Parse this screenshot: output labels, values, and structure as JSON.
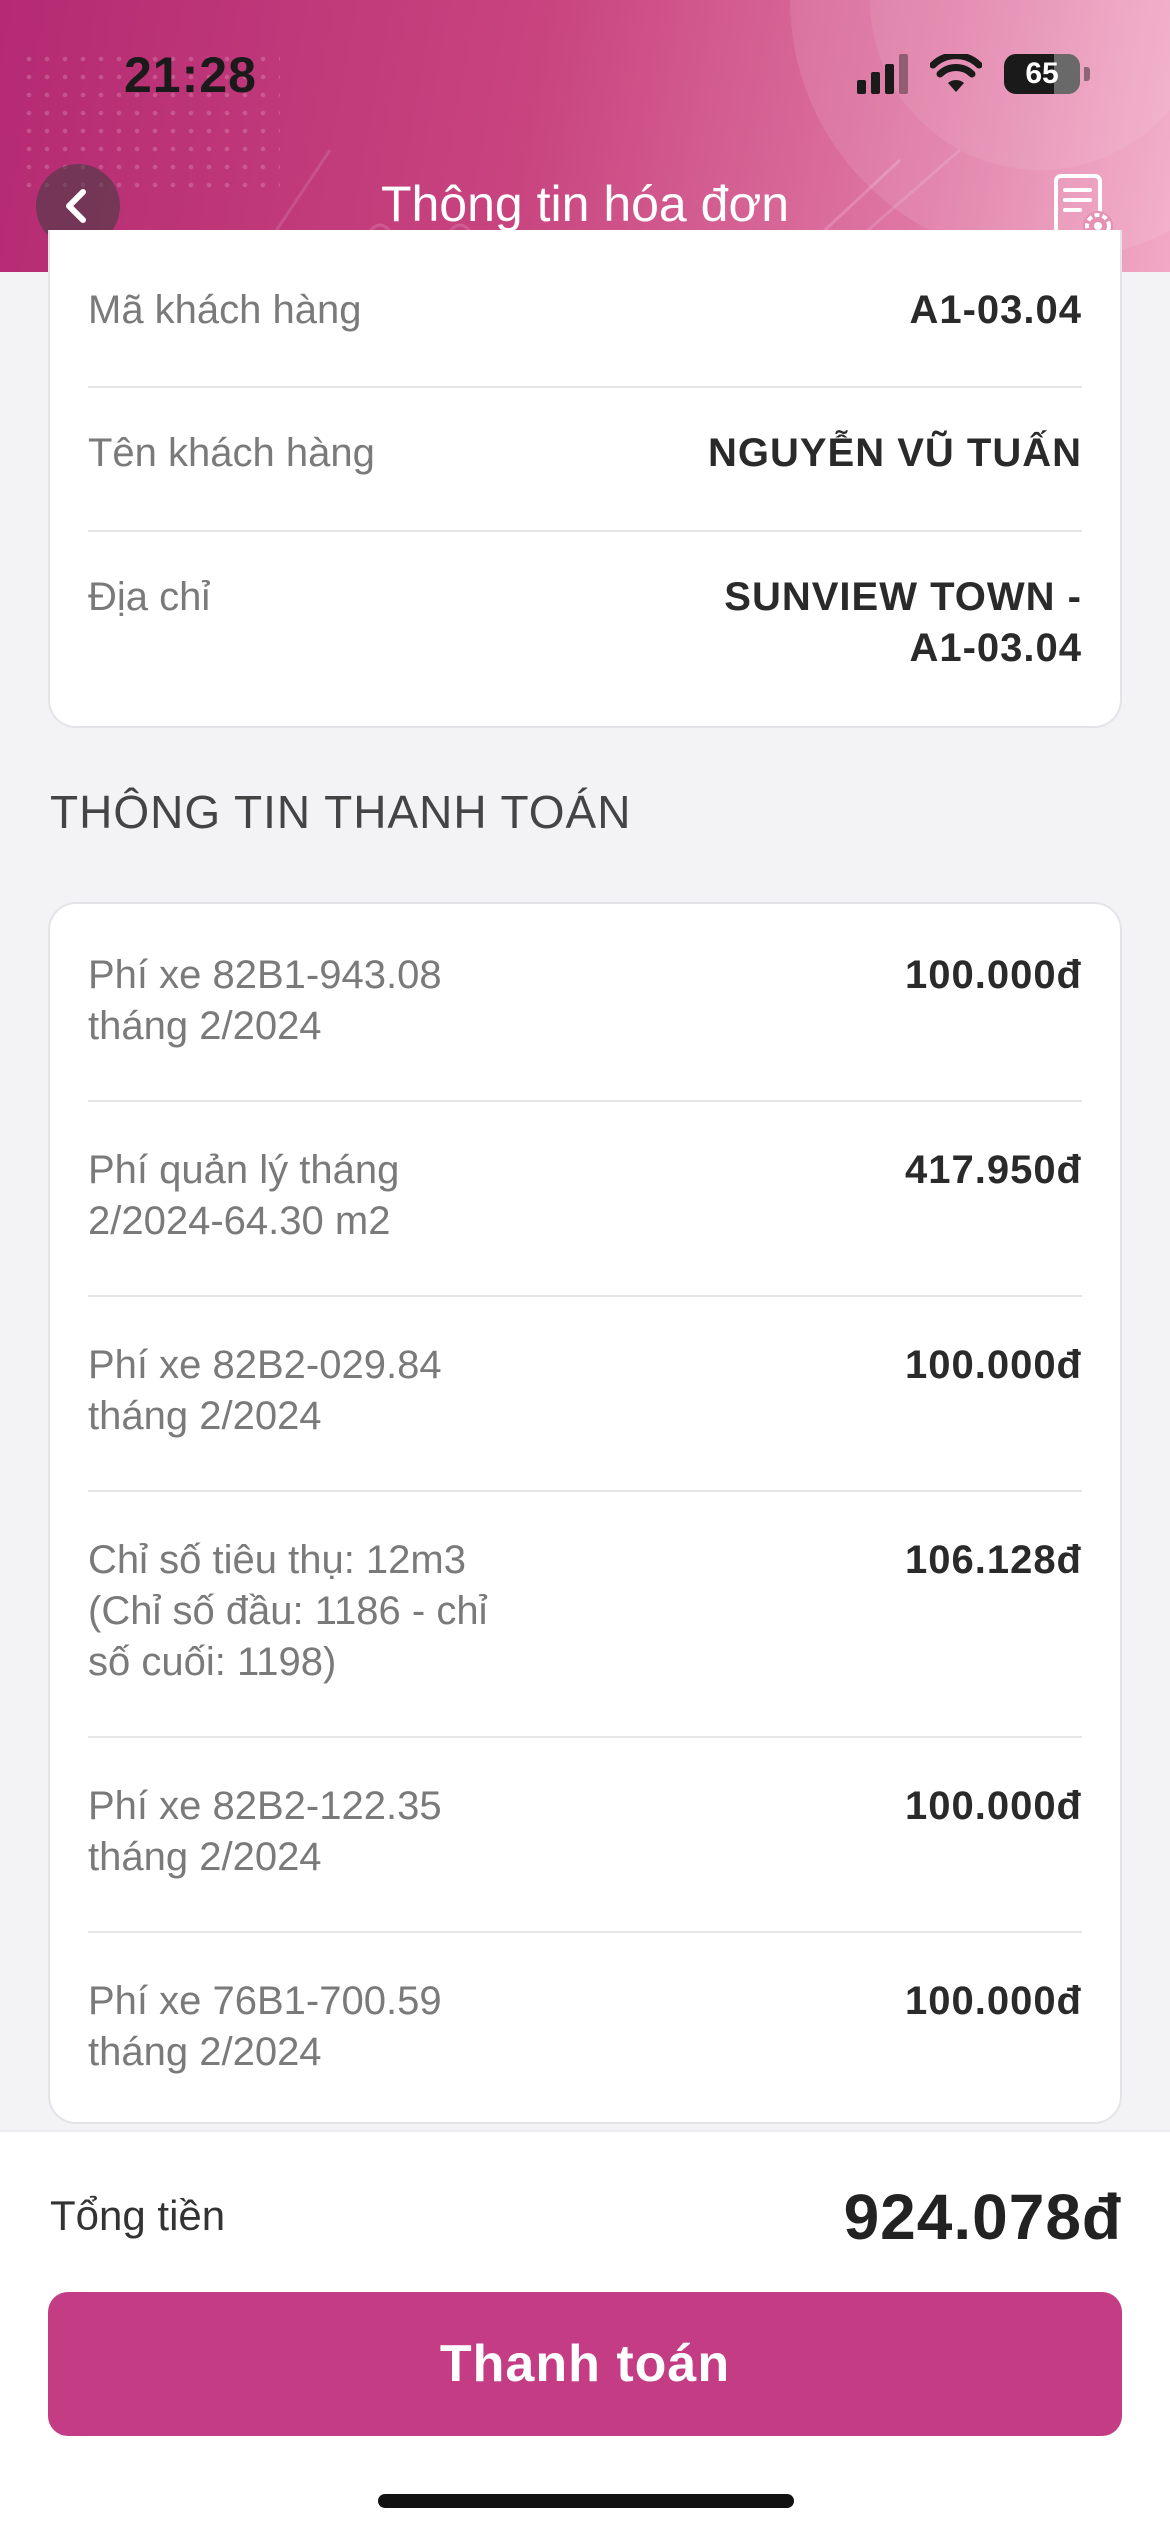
{
  "status_bar": {
    "time": "21:28",
    "battery": "65",
    "icons": [
      "signal-icon",
      "wifi-icon",
      "battery-icon"
    ]
  },
  "header": {
    "title": "Thông tin hóa đơn",
    "back_icon": "chevron-left-icon",
    "right_icon": "invoice-settings-icon",
    "gradient": [
      "#b52a73",
      "#f2a9c5"
    ]
  },
  "customer": {
    "rows": [
      {
        "label": "Mã khách hàng",
        "value": "A1-03.04"
      },
      {
        "label": "Tên khách hàng",
        "value": "NGUYỄN VŨ TUẤN"
      },
      {
        "label": "Địa chỉ",
        "value_line1": "SUNVIEW TOWN -",
        "value_line2": "A1-03.04"
      }
    ]
  },
  "payment": {
    "section_title": "THÔNG TIN THANH TOÁN",
    "items": [
      {
        "line1": "Phí xe 82B1-943.08",
        "line2": "tháng 2/2024",
        "amount": "100.000đ"
      },
      {
        "line1": "Phí quản lý tháng",
        "line2": "2/2024-64.30 m2",
        "amount": "417.950đ"
      },
      {
        "line1": "Phí xe 82B2-029.84",
        "line2": "tháng 2/2024",
        "amount": "100.000đ"
      },
      {
        "line1": "Chỉ số tiêu thụ: 12m3",
        "line2": "(Chỉ số đầu: 1186 - chỉ",
        "line3": "số cuối: 1198)",
        "amount": "106.128đ"
      },
      {
        "line1": "Phí xe 82B2-122.35",
        "line2": "tháng 2/2024",
        "amount": "100.000đ"
      },
      {
        "line1": "Phí xe 76B1-700.59",
        "line2": "tháng 2/2024",
        "amount": "100.000đ"
      }
    ]
  },
  "footer": {
    "total_label": "Tổng tiền",
    "total_value": "924.078đ",
    "pay_button": "Thanh toán",
    "accent": "#c43d84"
  }
}
